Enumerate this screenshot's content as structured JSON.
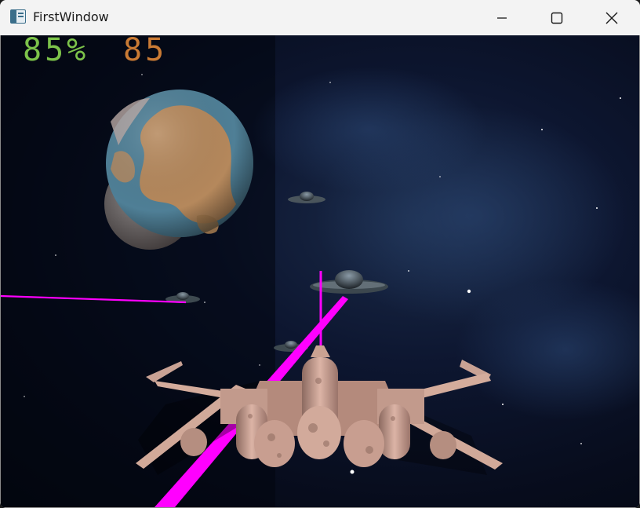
{
  "window": {
    "title": "FirstWindow",
    "icons": {
      "app": "app-window-icon",
      "minimize": "minimize-icon",
      "maximize": "maximize-icon",
      "close": "close-icon"
    }
  },
  "hud": {
    "shield_text": "85%",
    "score_text": "85",
    "shield_color": "#7cc24a",
    "score_color": "#c97a34"
  },
  "colors": {
    "laser": "#ff00ff",
    "ship_hull": "#c9a294",
    "planet_ocean": "#4f7f96",
    "planet_land": "#c08a55"
  }
}
